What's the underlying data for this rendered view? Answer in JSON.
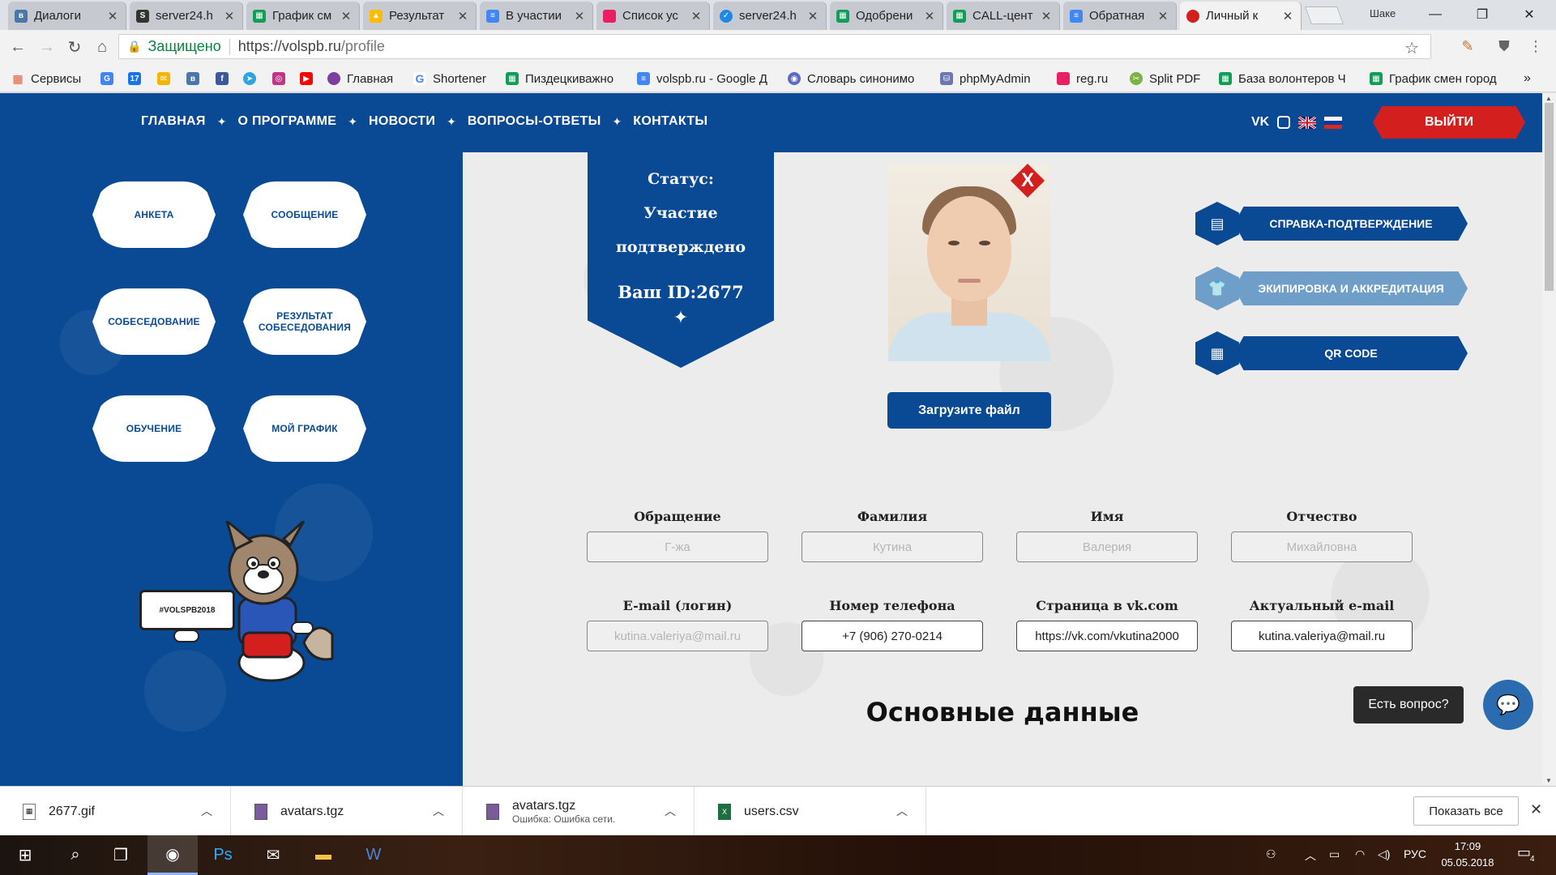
{
  "browser": {
    "tabs": [
      {
        "title": "Диалоги",
        "favicon_color": "#4a76a8",
        "favicon": "vk-icon"
      },
      {
        "title": "server24.h",
        "favicon_color": "#333333",
        "favicon": "server-icon"
      },
      {
        "title": "График см",
        "favicon_color": "#0f9d58",
        "favicon": "sheets-icon"
      },
      {
        "title": "Результат",
        "favicon_color": "#fbbc04",
        "favicon": "drive-icon"
      },
      {
        "title": "В участии",
        "favicon_color": "#4285f4",
        "favicon": "docs-icon"
      },
      {
        "title": "Список ус",
        "favicon_color": "#e91e63",
        "favicon": "page-icon"
      },
      {
        "title": "server24.h",
        "favicon_color": "#1e88e5",
        "favicon": "server-icon"
      },
      {
        "title": "Одобрени",
        "favicon_color": "#0f9d58",
        "favicon": "sheets-icon"
      },
      {
        "title": "CALL-цент",
        "favicon_color": "#0f9d58",
        "favicon": "sheets-icon"
      },
      {
        "title": "Обратная",
        "favicon_color": "#4285f4",
        "favicon": "docs-icon"
      },
      {
        "title": "Личный к",
        "favicon_color": "#d41f1f",
        "favicon": "site-icon",
        "active": true
      }
    ],
    "user_label": "Шаке",
    "window_controls": {
      "minimize": "—",
      "restore": "❐",
      "close": "✕"
    },
    "address": {
      "secure_label": "Защищено",
      "url_host": "https://volspb.ru",
      "url_path": "/profile"
    },
    "bookmarks": [
      {
        "label": "Сервисы",
        "icon": "apps-icon",
        "color": "#555555"
      },
      {
        "label": "",
        "icon": "translate-icon",
        "color": "#4285f4"
      },
      {
        "label": "",
        "icon": "calendar-icon",
        "color": "#1a73e8"
      },
      {
        "label": "",
        "icon": "mail-icon",
        "color": "#f4b400"
      },
      {
        "label": "",
        "icon": "vk-icon",
        "color": "#4a76a8"
      },
      {
        "label": "",
        "icon": "facebook-icon",
        "color": "#3b5998"
      },
      {
        "label": "",
        "icon": "telegram-icon",
        "color": "#2ca5e0"
      },
      {
        "label": "",
        "icon": "instagram-icon",
        "color": "#c13584"
      },
      {
        "label": "",
        "icon": "youtube-icon",
        "color": "#ff0000"
      },
      {
        "label": "Главная",
        "icon": "site-icon",
        "color": "#7a3fa0"
      },
      {
        "label": "Shortener",
        "icon": "google-icon",
        "color": "#4285f4"
      },
      {
        "label": "Пиздецкиважно",
        "icon": "sheets-icon",
        "color": "#0f9d58"
      },
      {
        "label": "volspb.ru - Google Д",
        "icon": "docs-icon",
        "color": "#4285f4"
      },
      {
        "label": "Словарь синонимо",
        "icon": "globe-icon",
        "color": "#5c6bc0"
      },
      {
        "label": "phpMyAdmin",
        "icon": "database-icon",
        "color": "#6c78af"
      },
      {
        "label": "reg.ru",
        "icon": "page-icon",
        "color": "#e91e63"
      },
      {
        "label": "Split PDF",
        "icon": "pdf-icon",
        "color": "#7cb342"
      },
      {
        "label": "База волонтеров Ч",
        "icon": "sheets-icon",
        "color": "#0f9d58"
      },
      {
        "label": "График смен город",
        "icon": "sheets-icon",
        "color": "#0f9d58"
      }
    ]
  },
  "site": {
    "nav": [
      "ГЛАВНАЯ",
      "О ПРОГРАММЕ",
      "НОВОСТИ",
      "ВОПРОСЫ-ОТВЕТЫ",
      "КОНТАКТЫ"
    ],
    "nav_separator": "✦",
    "social": {
      "vk": "VK"
    },
    "logout_label": "ВЫЙТИ",
    "menu": [
      {
        "label": "АНКЕТА"
      },
      {
        "label": "СООБЩЕНИЕ"
      },
      {
        "label": "СОБЕСЕДОВАНИЕ"
      },
      {
        "label": "РЕЗУЛЬТАТ СОБЕСЕДОВАНИЯ"
      },
      {
        "label": "ОБУЧЕНИЕ"
      },
      {
        "label": "МОЙ ГРАФИК"
      }
    ],
    "hashtag": "#VOLSPB2018",
    "status": {
      "title": "Статус:",
      "line1": "Участие",
      "line2": "подтверждено",
      "id_label": "Ваш ID:2677",
      "spark": "✦"
    },
    "photo_delete": "X",
    "upload_label": "Загрузите файл",
    "actions": [
      {
        "label": "СПРАВКА-ПОДТВЕРЖДЕНИЕ",
        "icon": "document-icon",
        "enabled": true
      },
      {
        "label": "ЭКИПИРОВКА И АККРЕДИТАЦИЯ",
        "icon": "shirt-icon",
        "enabled": false
      },
      {
        "label": "QR CODE",
        "icon": "qr-icon",
        "enabled": true
      }
    ],
    "fields": [
      {
        "label": "Обращение",
        "value": "Г-жа",
        "readonly": true
      },
      {
        "label": "Фамилия",
        "value": "Кутина",
        "readonly": true
      },
      {
        "label": "Имя",
        "value": "Валерия",
        "readonly": true
      },
      {
        "label": "Отчество",
        "value": "Михайловна",
        "readonly": true
      },
      {
        "label": "E-mail (логин)",
        "value": "kutina.valeriya@mail.ru",
        "readonly": true
      },
      {
        "label": "Номер телефона",
        "value": "+7 (906) 270-0214",
        "readonly": false
      },
      {
        "label": "Страница в vk.com",
        "value": "https://vk.com/vkutina2000",
        "readonly": false
      },
      {
        "label": "Актуальный e-mail",
        "value": "kutina.valeriya@mail.ru",
        "readonly": false
      }
    ],
    "section_title": "Основные данные",
    "chat_tip": "Есть вопрос?"
  },
  "downloads": {
    "items": [
      {
        "name": "2677.gif",
        "sub": "",
        "icon": "image-file-icon"
      },
      {
        "name": "avatars.tgz",
        "sub": "",
        "icon": "archive-file-icon"
      },
      {
        "name": "avatars.tgz",
        "sub": "Ошибка: Ошибка сети.",
        "icon": "archive-file-icon"
      },
      {
        "name": "users.csv",
        "sub": "",
        "icon": "excel-file-icon"
      }
    ],
    "show_all": "Показать все"
  },
  "taskbar": {
    "lang": "РУС",
    "time": "17:09",
    "date": "05.05.2018",
    "notifications": "4"
  },
  "colors": {
    "brand_blue": "#0a4a94",
    "accent_red": "#d41f1f",
    "content_bg": "#ececec"
  }
}
